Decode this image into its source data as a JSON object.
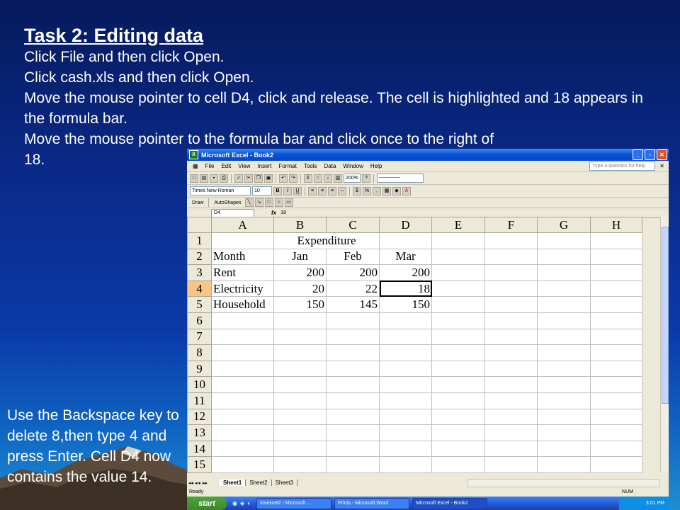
{
  "slide": {
    "title": "Task 2: Editing data",
    "lines": [
      "Click File and then click Open.",
      "Click cash.xls and then click Open.",
      "Move the mouse pointer to cell D4, click and release. The cell is highlighted and 18 appears in the formula bar.",
      "Move the mouse pointer to the formula bar and click once to the right of 18."
    ],
    "side_note": "Use the Backspace key to delete 8,then type 4 and press Enter. Cell D4 now contains the value 14."
  },
  "excel": {
    "window_title": "Microsoft Excel - Book2",
    "menu": [
      "File",
      "Edit",
      "View",
      "Insert",
      "Format",
      "Tools",
      "Data",
      "Window",
      "Help"
    ],
    "help_placeholder": "Type a question for help",
    "zoom": "200%",
    "font_name": "Times New Roman",
    "font_size": "10",
    "draw_label": "Draw",
    "autoshapes_label": "AutoShapes",
    "name_box": "D4",
    "fx_label": "fx",
    "formula_value": "18",
    "columns": [
      "A",
      "B",
      "C",
      "D",
      "E",
      "F",
      "G",
      "H"
    ],
    "rows": [
      {
        "n": "1",
        "cells": [
          "",
          "Expenditure",
          "",
          "",
          "",
          "",
          "",
          ""
        ]
      },
      {
        "n": "2",
        "cells": [
          "Month",
          "Jan",
          "Feb",
          "Mar",
          "",
          "",
          "",
          ""
        ]
      },
      {
        "n": "3",
        "cells": [
          "Rent",
          "200",
          "200",
          "200",
          "",
          "",
          "",
          ""
        ]
      },
      {
        "n": "4",
        "cells": [
          "Electricity",
          "20",
          "22",
          "18",
          "",
          "",
          "",
          ""
        ]
      },
      {
        "n": "5",
        "cells": [
          "Household",
          "150",
          "145",
          "150",
          "",
          "",
          "",
          ""
        ]
      },
      {
        "n": "6",
        "cells": [
          "",
          "",
          "",
          "",
          "",
          "",
          "",
          ""
        ]
      },
      {
        "n": "7",
        "cells": [
          "",
          "",
          "",
          "",
          "",
          "",
          "",
          ""
        ]
      },
      {
        "n": "8",
        "cells": [
          "",
          "",
          "",
          "",
          "",
          "",
          "",
          ""
        ]
      },
      {
        "n": "9",
        "cells": [
          "",
          "",
          "",
          "",
          "",
          "",
          "",
          ""
        ]
      },
      {
        "n": "10",
        "cells": [
          "",
          "",
          "",
          "",
          "",
          "",
          "",
          ""
        ]
      },
      {
        "n": "11",
        "cells": [
          "",
          "",
          "",
          "",
          "",
          "",
          "",
          ""
        ]
      },
      {
        "n": "12",
        "cells": [
          "",
          "",
          "",
          "",
          "",
          "",
          "",
          ""
        ]
      },
      {
        "n": "13",
        "cells": [
          "",
          "",
          "",
          "",
          "",
          "",
          "",
          ""
        ]
      },
      {
        "n": "14",
        "cells": [
          "",
          "",
          "",
          "",
          "",
          "",
          "",
          ""
        ]
      },
      {
        "n": "15",
        "cells": [
          "",
          "",
          "",
          "",
          "",
          "",
          "",
          ""
        ]
      }
    ],
    "sheets": [
      "Sheet1",
      "Sheet2",
      "Sheet3"
    ],
    "status": "Ready",
    "num_indicator": "NUM",
    "taskbar": {
      "start": "start",
      "tasks": [
        "msexcel2 - Microsoft ...",
        "Prints - Microsoft Word",
        "Microsoft Excel - Book2"
      ],
      "clock": "3:01 PM"
    }
  }
}
